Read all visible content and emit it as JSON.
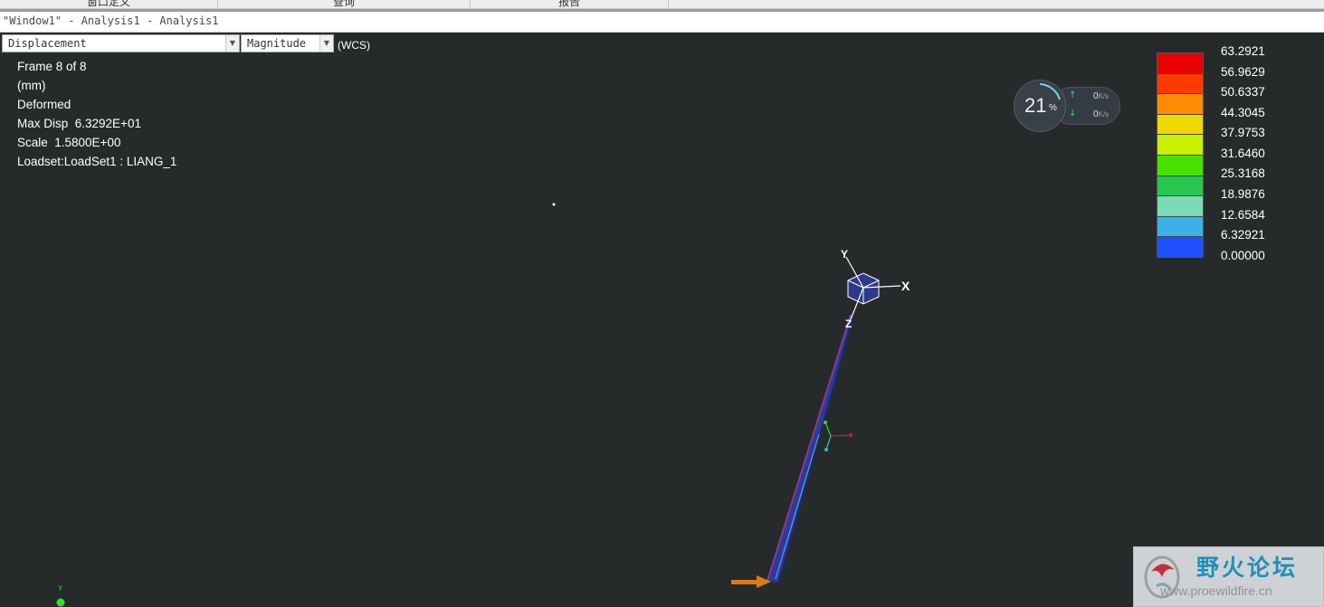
{
  "top_tabs": [
    "窗口定义",
    "查询",
    "报告"
  ],
  "window_title": "\"Window1\" - Analysis1 - Analysis1",
  "result_type": {
    "value": "Displacement"
  },
  "component": {
    "value": "Magnitude"
  },
  "coord_system": "(WCS)",
  "info": {
    "frame": "Frame 8 of 8",
    "units": "(mm)",
    "mode": "Deformed",
    "max_disp": "Max Disp  6.3292E+01",
    "scale": "Scale  1.5800E+00",
    "loadset": "Loadset:LoadSet1 : LIANG_1"
  },
  "legend": {
    "labels": [
      "63.2921",
      "56.9629",
      "50.6337",
      "44.3045",
      "37.9753",
      "31.6460",
      "25.3168",
      "18.9876",
      "12.6584",
      "6.32921",
      "0.00000"
    ],
    "colors": [
      "#e60000",
      "#ff3a00",
      "#ff8c00",
      "#f0d800",
      "#c8f000",
      "#48e000",
      "#28c850",
      "#7adcb4",
      "#3cb0e8",
      "#1e50ff",
      "#1a1a9a"
    ]
  },
  "monitor": {
    "percent": "21",
    "percent_unit": "%",
    "upload_value": "0",
    "download_value": "0",
    "speed_unit": "K/s"
  },
  "axis_labels": {
    "x": "X",
    "y": "Y",
    "z": "Z",
    "mini_y": "Y"
  },
  "watermark": {
    "title": "野火论坛",
    "url": "www.proewildfire.cn"
  },
  "colors": {
    "background": "#262a2b",
    "load_arrow": "#e07a10",
    "beam_main": "#3a4aa8",
    "beam_edge": "#8a3a8a"
  }
}
